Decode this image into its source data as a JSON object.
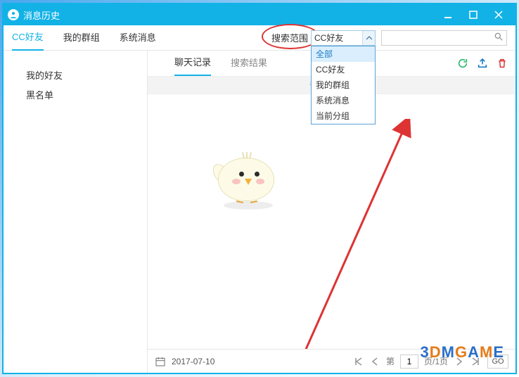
{
  "window": {
    "title": "消息历史"
  },
  "tabs": {
    "friends": "CC好友",
    "groups": "我的群组",
    "system": "系统消息"
  },
  "search": {
    "scope_label": "搜索范围",
    "scope_value": "CC好友",
    "options": {
      "all": "全部",
      "friends": "CC好友",
      "groups": "我的群组",
      "system": "系统消息",
      "current": "当前分组"
    },
    "placeholder": ""
  },
  "sidebar": {
    "my_friends": "我的好友",
    "blacklist": "黑名单"
  },
  "subtabs": {
    "chatlog": "聊天记录",
    "results": "搜索结果"
  },
  "hint": "请选择",
  "footer": {
    "date": "2017-07-10",
    "page_label_prefix": "第",
    "page_value": "1",
    "page_label_suffix": "页/1页",
    "go": "GO"
  },
  "watermark": "3DMGAME",
  "colors": {
    "accent": "#12b2e7",
    "danger": "#d33",
    "refresh": "#25b76a",
    "export": "#1a7cc7"
  }
}
